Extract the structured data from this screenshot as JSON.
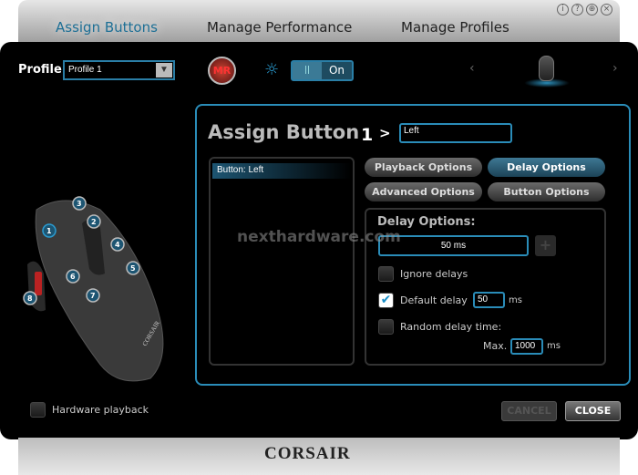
{
  "tabs": [
    {
      "label": "Assign Buttons",
      "active": true
    },
    {
      "label": "Manage Performance",
      "active": false
    },
    {
      "label": "Manage Profiles",
      "active": false
    }
  ],
  "window_icons": [
    "info-icon",
    "help-icon",
    "globe-icon",
    "close-icon"
  ],
  "profile": {
    "label": "Profile",
    "value": "Profile 1"
  },
  "macro_record": {
    "label": "MR"
  },
  "lighting": {
    "toggle_label": "On",
    "knob": "||"
  },
  "assign": {
    "title": "Assign Button",
    "button_number": "1",
    "arrow": ">",
    "name_value": "Left"
  },
  "list": {
    "items": [
      "Button: Left"
    ]
  },
  "option_tabs": [
    {
      "label": "Playback Options",
      "active": false
    },
    {
      "label": "Delay Options",
      "active": true
    },
    {
      "label": "Advanced Options",
      "active": false
    },
    {
      "label": "Button Options",
      "active": false
    }
  ],
  "delay": {
    "heading": "Delay Options:",
    "value": "50 ms",
    "add": "+",
    "ignore": {
      "label": "Ignore delays",
      "checked": false
    },
    "default": {
      "label": "Default delay",
      "checked": true,
      "value": "50",
      "unit": "ms"
    },
    "random": {
      "label": "Random delay time:",
      "checked": false,
      "max_label": "Max.",
      "max_value": "1000",
      "unit": "ms"
    }
  },
  "mouse_buttons": [
    "1",
    "2",
    "3",
    "4",
    "5",
    "6",
    "7",
    "8"
  ],
  "hardware_playback": {
    "label": "Hardware playback",
    "checked": false
  },
  "footer": {
    "cancel": "CANCEL",
    "close": "CLOSE",
    "logo": "CORSAIR"
  },
  "watermark": "nexthardware.com",
  "colors": {
    "accent": "#2a8cb8",
    "active_tab": "#1d6f95"
  }
}
